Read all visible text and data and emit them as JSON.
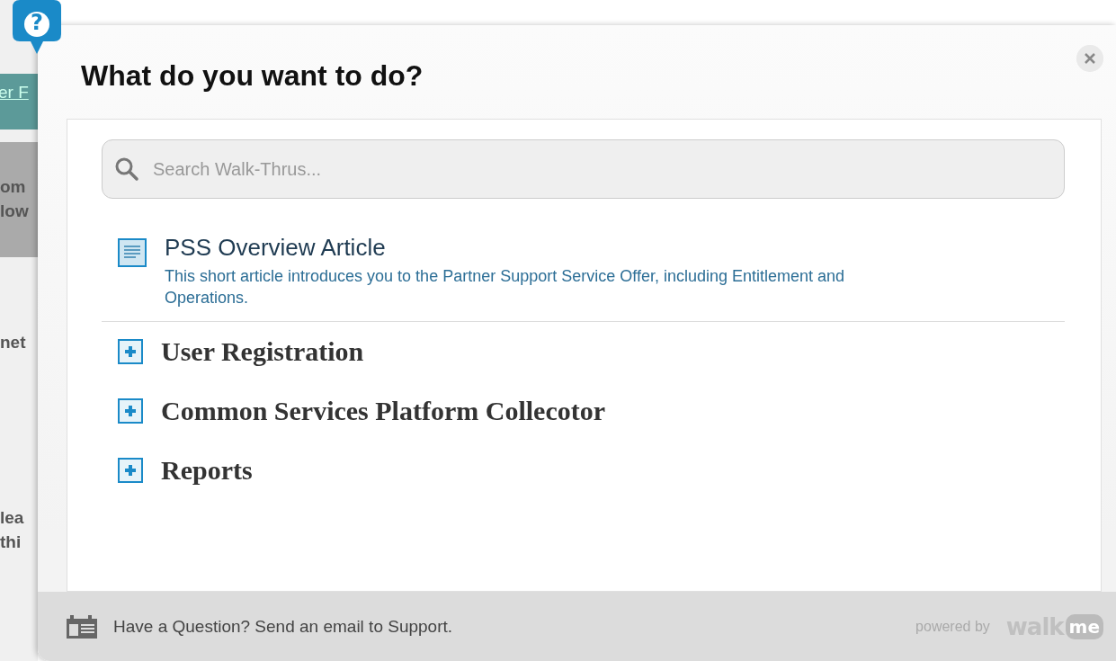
{
  "background_page": {
    "link": "er F",
    "block_lines": [
      "om",
      "low"
    ],
    "lines": [
      {
        "text": "net"
      },
      {
        "text": "lea"
      },
      {
        "text": "thi"
      }
    ]
  },
  "help_badge": "?",
  "dialog": {
    "title": "What do you want to do?",
    "search": {
      "placeholder": "Search Walk-Thrus..."
    },
    "articles": [
      {
        "title": "PSS Overview Article",
        "description": "This short article introduces you to the Partner Support Service Offer, including Entitlement and Operations."
      }
    ],
    "sections": [
      {
        "label": "User Registration",
        "expanded": false
      },
      {
        "label": "Common Services Platform Collecotor",
        "expanded": false
      },
      {
        "label": "Reports",
        "expanded": false
      }
    ],
    "footer": {
      "text": "Have a Question? Send an email to Support.",
      "powered_by": "powered by",
      "brand_word": "walk",
      "brand_badge": "me"
    }
  }
}
